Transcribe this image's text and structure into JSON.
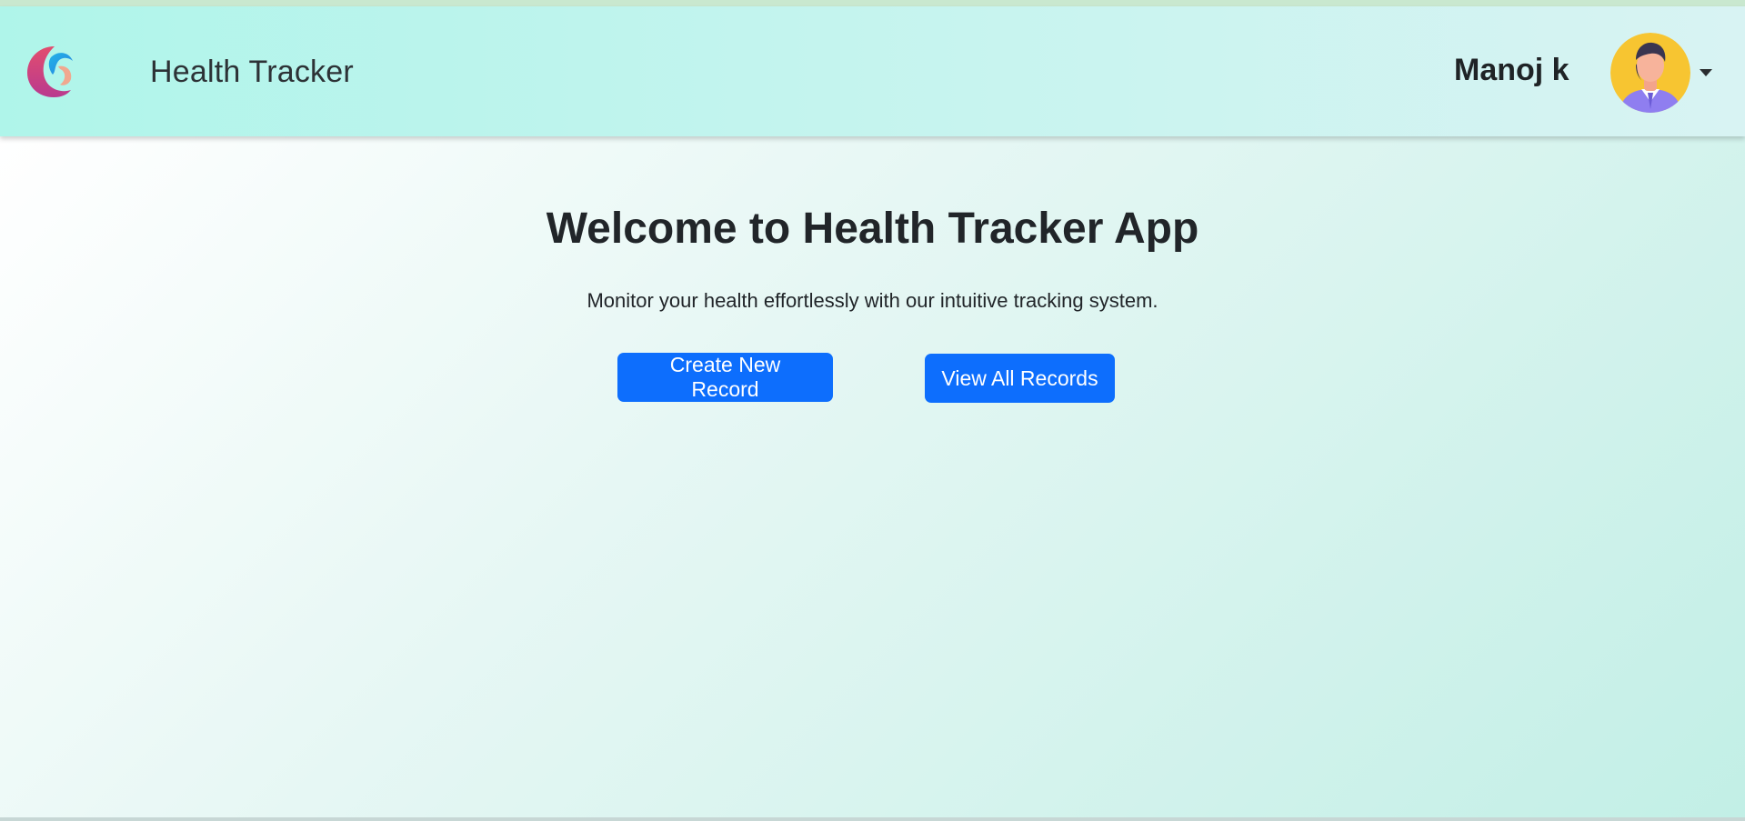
{
  "header": {
    "brand_name": "Health Tracker",
    "user_name": "Manoj k",
    "logo_icon": "crescent-swirl-logo",
    "avatar_icon": "user-avatar",
    "dropdown_icon": "caret-down-icon"
  },
  "hero": {
    "title": "Welcome to Health Tracker App",
    "subtitle": "Monitor your health effortlessly with our intuitive tracking system.",
    "buttons": [
      {
        "label": "Create New Record"
      },
      {
        "label": "View All Records"
      }
    ]
  },
  "colors": {
    "primary": "#0d6efd",
    "navbar_start": "#aff5ea",
    "navbar_end": "#d8f3f3",
    "avatar_bg": "#f7c531",
    "text": "#212529"
  }
}
